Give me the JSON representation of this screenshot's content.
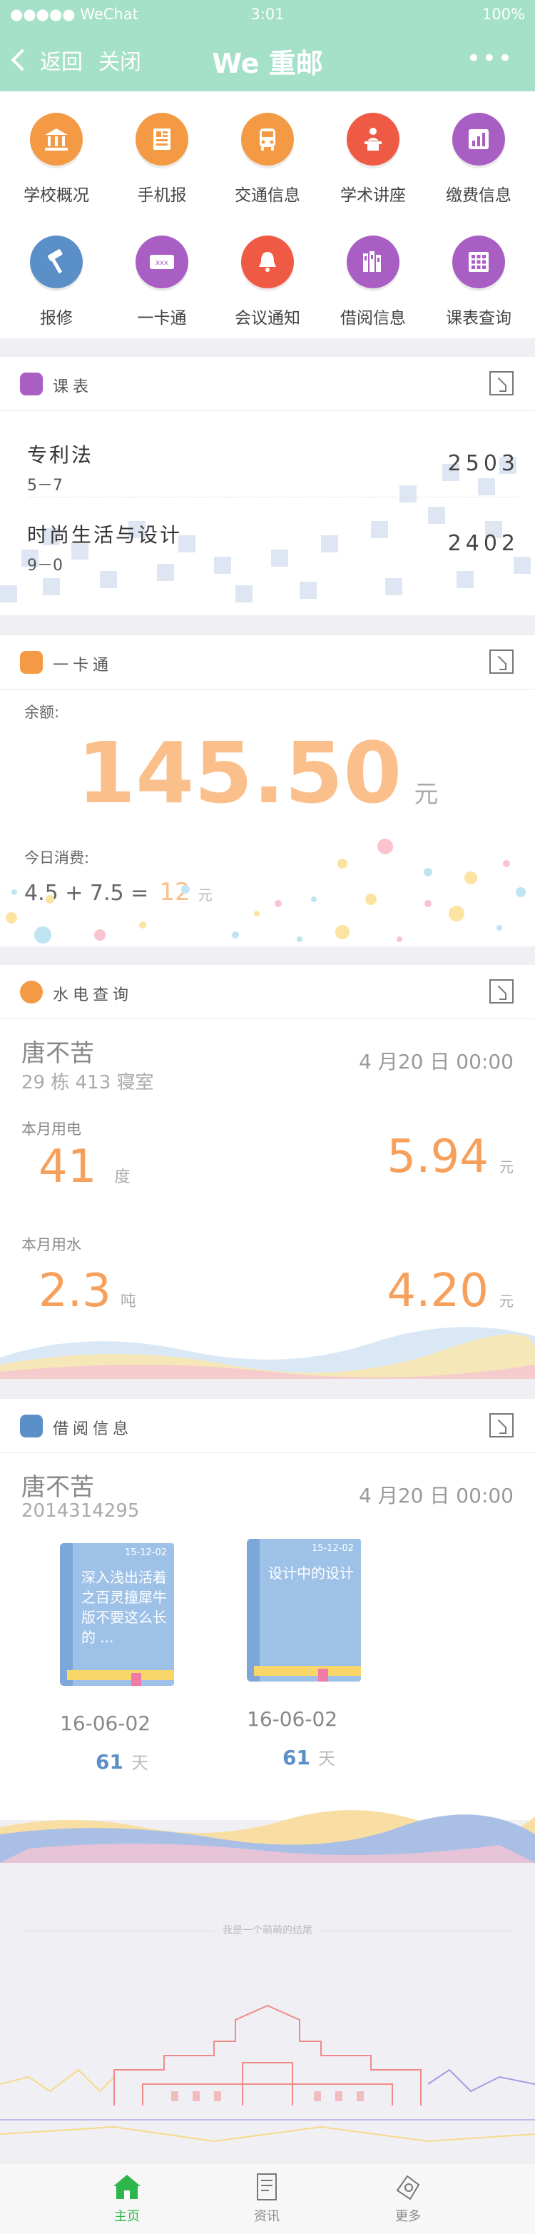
{
  "status": {
    "carrier": "●●●●● WeChat",
    "time": "3:01",
    "battery": "100%"
  },
  "nav": {
    "back": "返回",
    "close": "关闭",
    "title": "We 重邮",
    "more": "•••"
  },
  "grid": [
    {
      "label": "学校概况",
      "color": "#f59a44",
      "icon": "bank-icon"
    },
    {
      "label": "手机报",
      "color": "#f59a44",
      "icon": "newspaper-icon"
    },
    {
      "label": "交通信息",
      "color": "#f59a44",
      "icon": "bus-icon"
    },
    {
      "label": "学术讲座",
      "color": "#ef5a45",
      "icon": "lecture-icon"
    },
    {
      "label": "缴费信息",
      "color": "#a95ec4",
      "icon": "bar-chart-icon"
    },
    {
      "label": "报修",
      "color": "#5b8fc7",
      "icon": "hammer-icon"
    },
    {
      "label": "一卡通",
      "color": "#a95ec4",
      "icon": "card-icon"
    },
    {
      "label": "会议通知",
      "color": "#ef5a45",
      "icon": "bell-icon"
    },
    {
      "label": "借阅信息",
      "color": "#a95ec4",
      "icon": "books-icon"
    },
    {
      "label": "课表查询",
      "color": "#a95ec4",
      "icon": "calendar-grid-icon"
    }
  ],
  "schedule": {
    "title": "课表",
    "courses": [
      {
        "name": "专利法",
        "time": "5－7",
        "room": "2503"
      },
      {
        "name": "时尚生活与设计",
        "time": "9－0",
        "room": "2402"
      }
    ]
  },
  "card": {
    "title": "一卡通",
    "balance_label": "余额:",
    "balance": "145.50",
    "unit": "元",
    "today_label": "今日消费:",
    "today_expr": "4.5 + 7.5 =",
    "today_total": "12",
    "today_unit": "元"
  },
  "utility": {
    "title": "水电查询",
    "name": "唐不苦",
    "room": "29 栋 413 寝室",
    "date": "4 月20 日 00:00",
    "elec_label": "本月用电",
    "elec_usage": "41",
    "elec_unit": "度",
    "elec_cost": "5.94",
    "elec_cost_unit": "元",
    "water_label": "本月用水",
    "water_usage": "2.3",
    "water_unit": "吨",
    "water_cost": "4.20",
    "water_cost_unit": "元"
  },
  "borrow": {
    "title": "借阅信息",
    "name": "唐不苦",
    "id": "2014314295",
    "date": "4 月20 日 00:00",
    "books": [
      {
        "date_tag": "15-12-02",
        "title": "深入浅出活着之百灵撞犀牛版不要这么长的 ...",
        "due": "16-06-02",
        "days": "61",
        "days_unit": "天"
      },
      {
        "date_tag": "15-12-02",
        "title": "设计中的设计",
        "due": "16-06-02",
        "days": "61",
        "days_unit": "天"
      }
    ]
  },
  "end_text": "我是一个萌萌的结尾",
  "tabs": [
    {
      "label": "主页",
      "icon": "home-icon",
      "active": true
    },
    {
      "label": "资讯",
      "icon": "document-icon",
      "active": false
    },
    {
      "label": "更多",
      "icon": "more-icon",
      "active": false
    }
  ],
  "colors": {
    "accent": "#a5e0c9",
    "orange": "#f6a05c",
    "active_tab": "#2db64a"
  }
}
